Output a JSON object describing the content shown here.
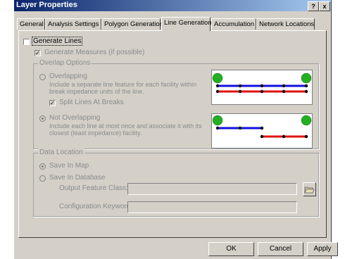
{
  "window": {
    "title": "Layer Properties",
    "help_label": "?",
    "close_label": "x"
  },
  "tabs": [
    {
      "label": "General"
    },
    {
      "label": "Analysis Settings"
    },
    {
      "label": "Polygon Generation"
    },
    {
      "label": "Line Generation"
    },
    {
      "label": "Accumulation"
    },
    {
      "label": "Network Locations"
    }
  ],
  "active_tab": "Line Generation",
  "generate_lines": {
    "label": "Generate Lines",
    "checked": false
  },
  "generate_measures": {
    "label": "Generate Measures (if possible)",
    "checked": true
  },
  "overlap_options": {
    "title": "Overlap Options",
    "overlapping": {
      "label": "Overlapping",
      "description_1": "Include a separate line feature for each facility within",
      "description_2": "break impedance units of the line."
    },
    "split_lines": {
      "label": "Split Lines At Breaks",
      "checked": true
    },
    "not_overlapping": {
      "label": "Not Overlapping",
      "selected": true,
      "description_1": "Include each line at most once and associate it with its",
      "description_2": "closest (least impedance) facility."
    }
  },
  "data_location": {
    "title": "Data Location",
    "save_in_map": {
      "label": "Save In Map",
      "selected": true
    },
    "save_in_database": {
      "label": "Save In Database",
      "selected": false
    },
    "output_feature_class": {
      "label": "Output Feature Class:",
      "value": ""
    },
    "configuration_keyword": {
      "label": "Configuration Keyword",
      "value": ""
    }
  },
  "buttons": {
    "ok": "OK",
    "cancel": "Cancel",
    "apply": "Apply"
  },
  "colors": {
    "blue_line": "#1010e0",
    "red_line": "#e01010",
    "facility": "#22b022",
    "title_blue": "#0a246a"
  }
}
